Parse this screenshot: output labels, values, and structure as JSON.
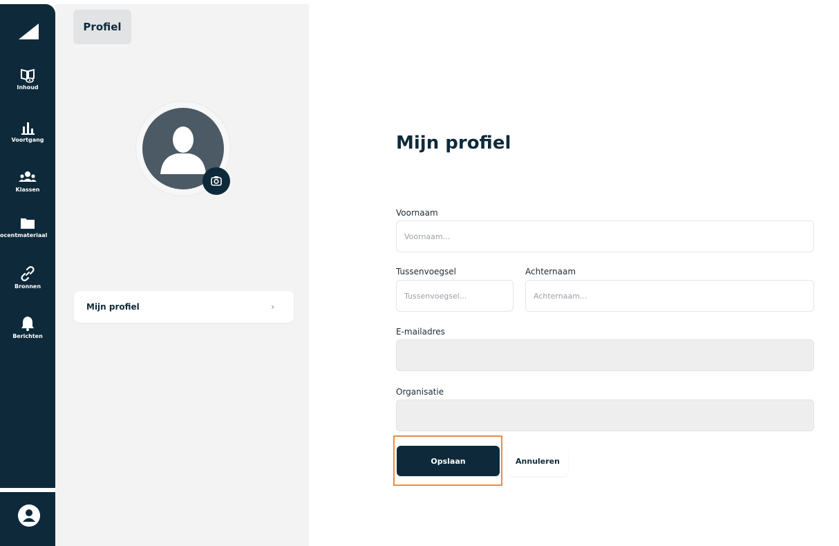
{
  "sidebar": {
    "items": [
      {
        "label": "Inhoud",
        "icon": "book-eye-icon"
      },
      {
        "label": "Voortgang",
        "icon": "bar-chart-icon"
      },
      {
        "label": "Klassen",
        "icon": "group-icon"
      },
      {
        "label": "ocentmateriaal",
        "icon": "folder-icon"
      },
      {
        "label": "Bronnen",
        "icon": "link-icon"
      },
      {
        "label": "Berichten",
        "icon": "bell-icon"
      }
    ]
  },
  "page_tab": "Profiel",
  "menu": {
    "items": [
      {
        "label": "Mijn profiel",
        "chevron": "›"
      }
    ]
  },
  "form": {
    "title": "Mijn profiel",
    "first_name": {
      "label": "Voornaam",
      "placeholder": "Voornaam...",
      "value": ""
    },
    "infix": {
      "label": "Tussenvoegsel",
      "placeholder": "Tussenvoegsel...",
      "value": ""
    },
    "last_name": {
      "label": "Achternaam",
      "placeholder": "Achternaam...",
      "value": ""
    },
    "email": {
      "label": "E-mailadres",
      "value": ""
    },
    "organisation": {
      "label": "Organisatie",
      "value": ""
    },
    "save_label": "Opslaan",
    "cancel_label": "Annuleren"
  },
  "colors": {
    "primary": "#0e2a3a",
    "highlight": "#f08a3c",
    "panel_bg": "#f3f3f3"
  }
}
